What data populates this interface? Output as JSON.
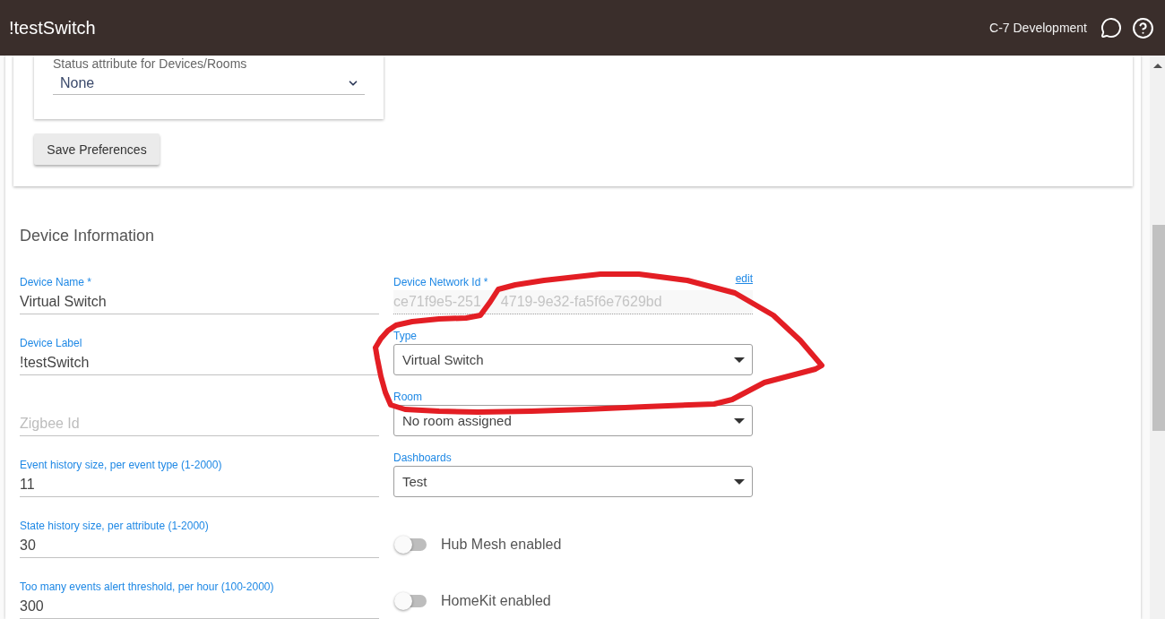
{
  "app_bar": {
    "title": "!testSwitch",
    "hub_name": "C-7 Development"
  },
  "preferences": {
    "status_attribute": {
      "label": "Status attribute for Devices/Rooms",
      "value": "None"
    },
    "save_button": "Save Preferences"
  },
  "device_information": {
    "heading": "Device Information",
    "left_fields": [
      {
        "kind": "text",
        "label": "Device Name *",
        "value": "Virtual Switch"
      },
      {
        "kind": "text",
        "label": "Device Label",
        "value": "!testSwitch"
      },
      {
        "kind": "text",
        "placeholder": "Zigbee Id"
      },
      {
        "kind": "text",
        "label": "Event history size, per event type (1-2000)",
        "value": "11"
      },
      {
        "kind": "text",
        "label": "State history size, per attribute (1-2000)",
        "value": "30"
      },
      {
        "kind": "text",
        "label": "Too many events alert threshold, per hour (100-2000)",
        "value": "300"
      }
    ],
    "right_fields": [
      {
        "kind": "readonly",
        "label": "Device Network Id *",
        "value_parts": [
          "ce71f9e5-251",
          "4719-9e32-fa5f6e7629bd"
        ],
        "link": "edit"
      },
      {
        "kind": "select",
        "label": "Type",
        "value": "Virtual Switch"
      },
      {
        "kind": "select",
        "label": "Room",
        "value": "No room assigned"
      },
      {
        "kind": "select",
        "label": "Dashboards",
        "value": "Test"
      },
      {
        "kind": "toggle",
        "label": "Hub Mesh enabled",
        "on": false
      },
      {
        "kind": "toggle",
        "label": "HomeKit enabled",
        "on": false
      }
    ]
  }
}
